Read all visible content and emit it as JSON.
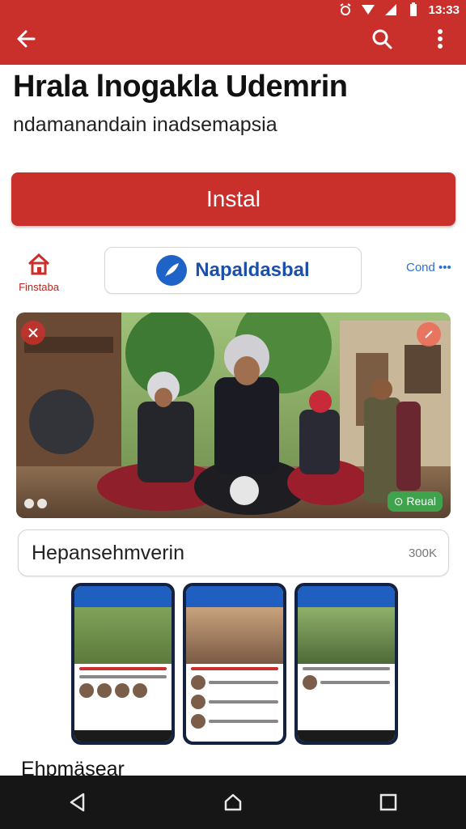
{
  "status_bar": {
    "time": "13:33"
  },
  "app": {
    "title": "Hrala lnogakla Udemrin",
    "subtitle": "ndamanandain inadsemapsia",
    "install_label": "Instal"
  },
  "developer": {
    "home_label": "Finstaba",
    "name": "Napaldasbal",
    "cont_label": "Cond •••"
  },
  "hero": {
    "badge_label": "Reual"
  },
  "field": {
    "text": "Hepansehmverin",
    "count": "300K"
  },
  "section": {
    "heading": "Ehpmäsear"
  },
  "colors": {
    "primary": "#c9302c",
    "accent_blue": "#1e63c7",
    "nav_bg": "#161616"
  },
  "icons": [
    "back-arrow-icon",
    "search-icon",
    "overflow-menu-icon",
    "home-icon",
    "nav-back-icon",
    "nav-home-icon",
    "nav-recents-icon"
  ]
}
